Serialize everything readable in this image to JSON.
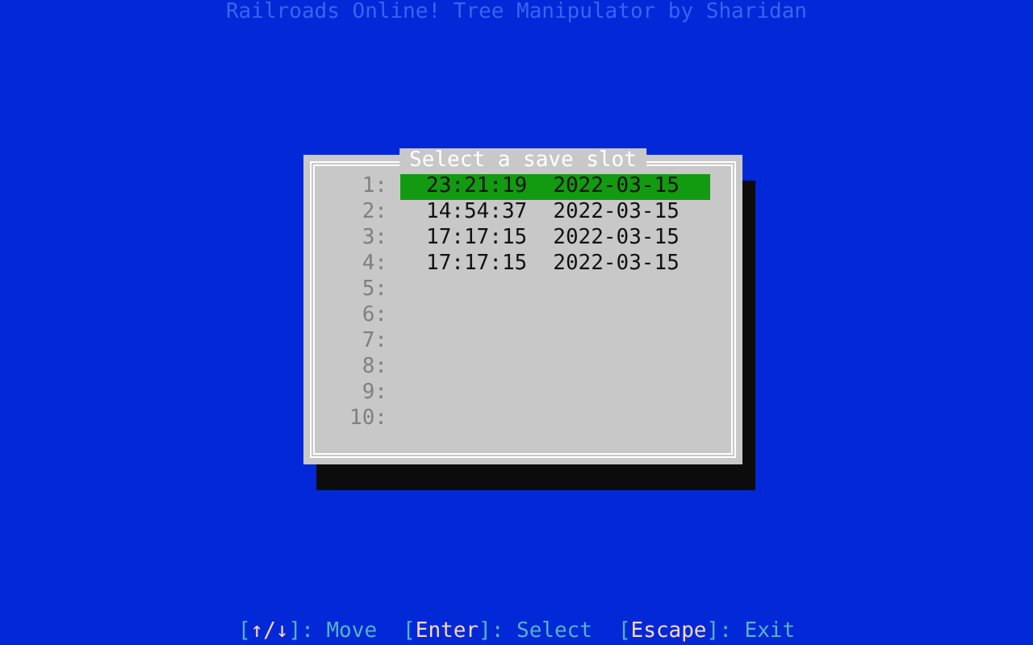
{
  "app_title": "Railroads Online! Tree Manipulator by Sharidan",
  "dialog": {
    "title": "Select a save slot",
    "slots": [
      {
        "number": "1:",
        "time": "23:21:19",
        "date": "2022-03-15",
        "selected": true
      },
      {
        "number": "2:",
        "time": "14:54:37",
        "date": "2022-03-15",
        "selected": false
      },
      {
        "number": "3:",
        "time": "17:17:15",
        "date": "2022-03-15",
        "selected": false
      },
      {
        "number": "4:",
        "time": "17:17:15",
        "date": "2022-03-15",
        "selected": false
      },
      {
        "number": "5:",
        "selected": false
      },
      {
        "number": "6:",
        "selected": false
      },
      {
        "number": "7:",
        "selected": false
      },
      {
        "number": "8:",
        "selected": false
      },
      {
        "number": "9:",
        "selected": false
      },
      {
        "number": "10:",
        "selected": false
      }
    ]
  },
  "hints": [
    {
      "open": "[",
      "key": "↑/↓",
      "close": "]: Move"
    },
    {
      "open": "[",
      "key": "Enter",
      "close": "]: Select"
    },
    {
      "open": "[",
      "key": "Escape",
      "close": "]: Exit"
    }
  ]
}
